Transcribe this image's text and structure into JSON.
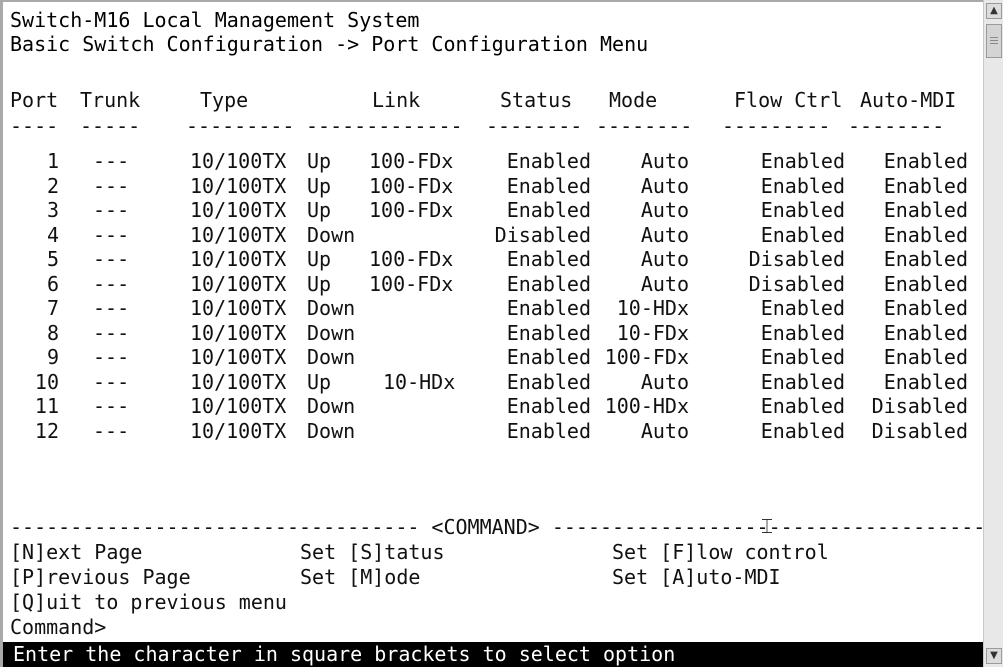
{
  "header": {
    "title": "Switch-M16 Local Management System",
    "breadcrumb": "Basic Switch Configuration -> Port Configuration Menu"
  },
  "table": {
    "columns": [
      "Port",
      "Trunk",
      "Type",
      "Link",
      "Status",
      "Mode",
      "Flow Ctrl",
      "Auto-MDI"
    ],
    "separators": [
      "----",
      "-----",
      "---------",
      "-------------",
      "--------",
      "--------",
      "---------",
      "--------"
    ],
    "rows": [
      {
        "port": "1",
        "trunk": "---",
        "type": "10/100TX",
        "link": "Up",
        "speed": "100-FDx",
        "status": "Enabled",
        "mode": "Auto",
        "flow": "Enabled",
        "mdi": "Enabled"
      },
      {
        "port": "2",
        "trunk": "---",
        "type": "10/100TX",
        "link": "Up",
        "speed": "100-FDx",
        "status": "Enabled",
        "mode": "Auto",
        "flow": "Enabled",
        "mdi": "Enabled"
      },
      {
        "port": "3",
        "trunk": "---",
        "type": "10/100TX",
        "link": "Up",
        "speed": "100-FDx",
        "status": "Enabled",
        "mode": "Auto",
        "flow": "Enabled",
        "mdi": "Enabled"
      },
      {
        "port": "4",
        "trunk": "---",
        "type": "10/100TX",
        "link": "Down",
        "speed": "",
        "status": "Disabled",
        "mode": "Auto",
        "flow": "Enabled",
        "mdi": "Enabled"
      },
      {
        "port": "5",
        "trunk": "---",
        "type": "10/100TX",
        "link": "Up",
        "speed": "100-FDx",
        "status": "Enabled",
        "mode": "Auto",
        "flow": "Disabled",
        "mdi": "Enabled"
      },
      {
        "port": "6",
        "trunk": "---",
        "type": "10/100TX",
        "link": "Up",
        "speed": "100-FDx",
        "status": "Enabled",
        "mode": "Auto",
        "flow": "Disabled",
        "mdi": "Enabled"
      },
      {
        "port": "7",
        "trunk": "---",
        "type": "10/100TX",
        "link": "Down",
        "speed": "",
        "status": "Enabled",
        "mode": "10-HDx",
        "flow": "Enabled",
        "mdi": "Enabled"
      },
      {
        "port": "8",
        "trunk": "---",
        "type": "10/100TX",
        "link": "Down",
        "speed": "",
        "status": "Enabled",
        "mode": "10-FDx",
        "flow": "Enabled",
        "mdi": "Enabled"
      },
      {
        "port": "9",
        "trunk": "---",
        "type": "10/100TX",
        "link": "Down",
        "speed": "",
        "status": "Enabled",
        "mode": "100-FDx",
        "flow": "Enabled",
        "mdi": "Enabled"
      },
      {
        "port": "10",
        "trunk": "---",
        "type": "10/100TX",
        "link": "Up",
        "speed": "10-HDx",
        "status": "Enabled",
        "mode": "Auto",
        "flow": "Enabled",
        "mdi": "Enabled"
      },
      {
        "port": "11",
        "trunk": "---",
        "type": "10/100TX",
        "link": "Down",
        "speed": "",
        "status": "Enabled",
        "mode": "100-HDx",
        "flow": "Enabled",
        "mdi": "Disabled"
      },
      {
        "port": "12",
        "trunk": "---",
        "type": "10/100TX",
        "link": "Down",
        "speed": "",
        "status": "Enabled",
        "mode": "Auto",
        "flow": "Enabled",
        "mdi": "Disabled"
      }
    ]
  },
  "command": {
    "divider": "---------------------------------- <COMMAND> -----------------------------------------",
    "options": {
      "next_page": "[N]ext Page",
      "previous_page": "[P]revious Page",
      "quit": "[Q]uit to previous menu",
      "set_status": "Set [S]tatus",
      "set_mode": "Set [M]ode",
      "set_flow": "Set [F]low control",
      "set_mdi": "Set [A]uto-MDI"
    },
    "prompt": "Command>"
  },
  "status_bar": {
    "message": "Enter the character in square brackets to select option"
  },
  "icons": {
    "scroll_up": "scroll-up-arrow-icon",
    "scroll_down": "scroll-down-arrow-icon",
    "text_cursor": "i-beam-cursor-icon"
  },
  "colors": {
    "background": "#ffffff",
    "text": "#111111",
    "status_bar_bg": "#000000",
    "status_bar_text": "#ffffff"
  }
}
